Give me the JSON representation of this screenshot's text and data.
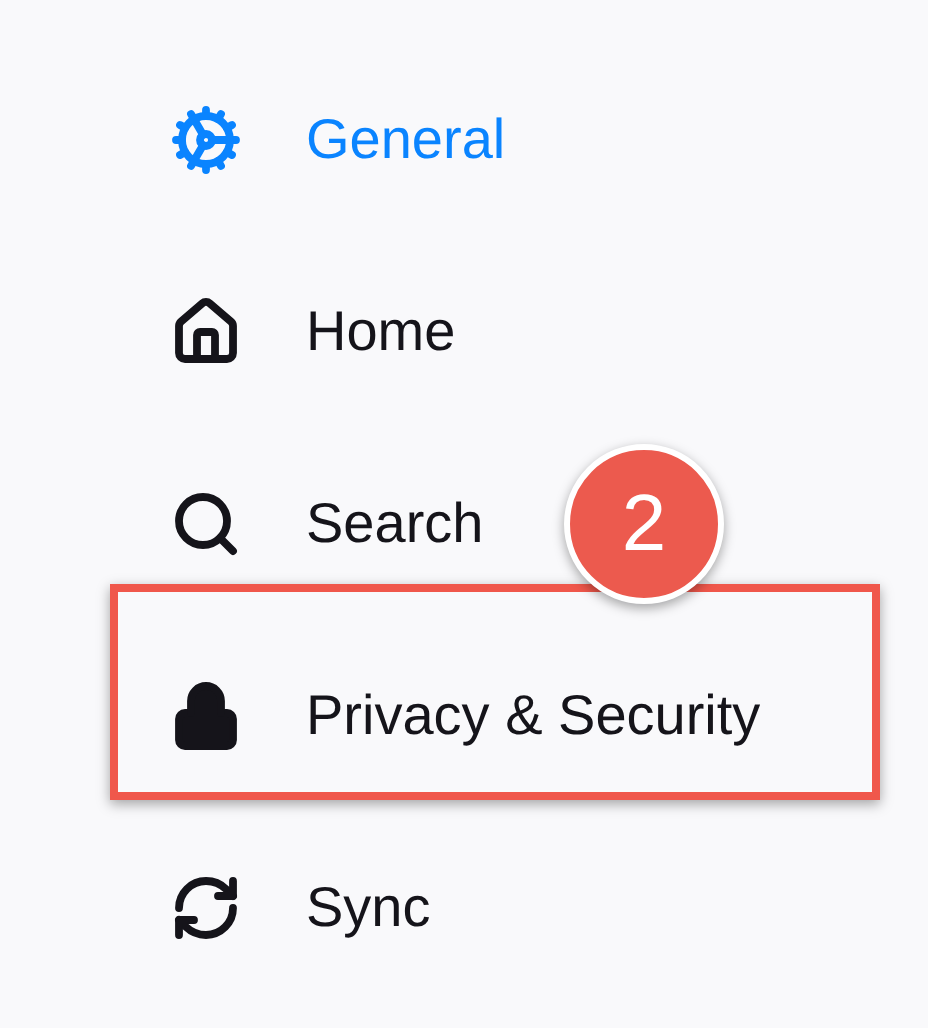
{
  "nav_items": [
    {
      "label": "General",
      "selected": true,
      "highlighted": false
    },
    {
      "label": "Home",
      "selected": false,
      "highlighted": false
    },
    {
      "label": "Search",
      "selected": false,
      "highlighted": false
    },
    {
      "label": "Privacy & Security",
      "selected": false,
      "highlighted": true
    },
    {
      "label": "Sync",
      "selected": false,
      "highlighted": false
    }
  ],
  "step_badge": {
    "text": "2"
  }
}
